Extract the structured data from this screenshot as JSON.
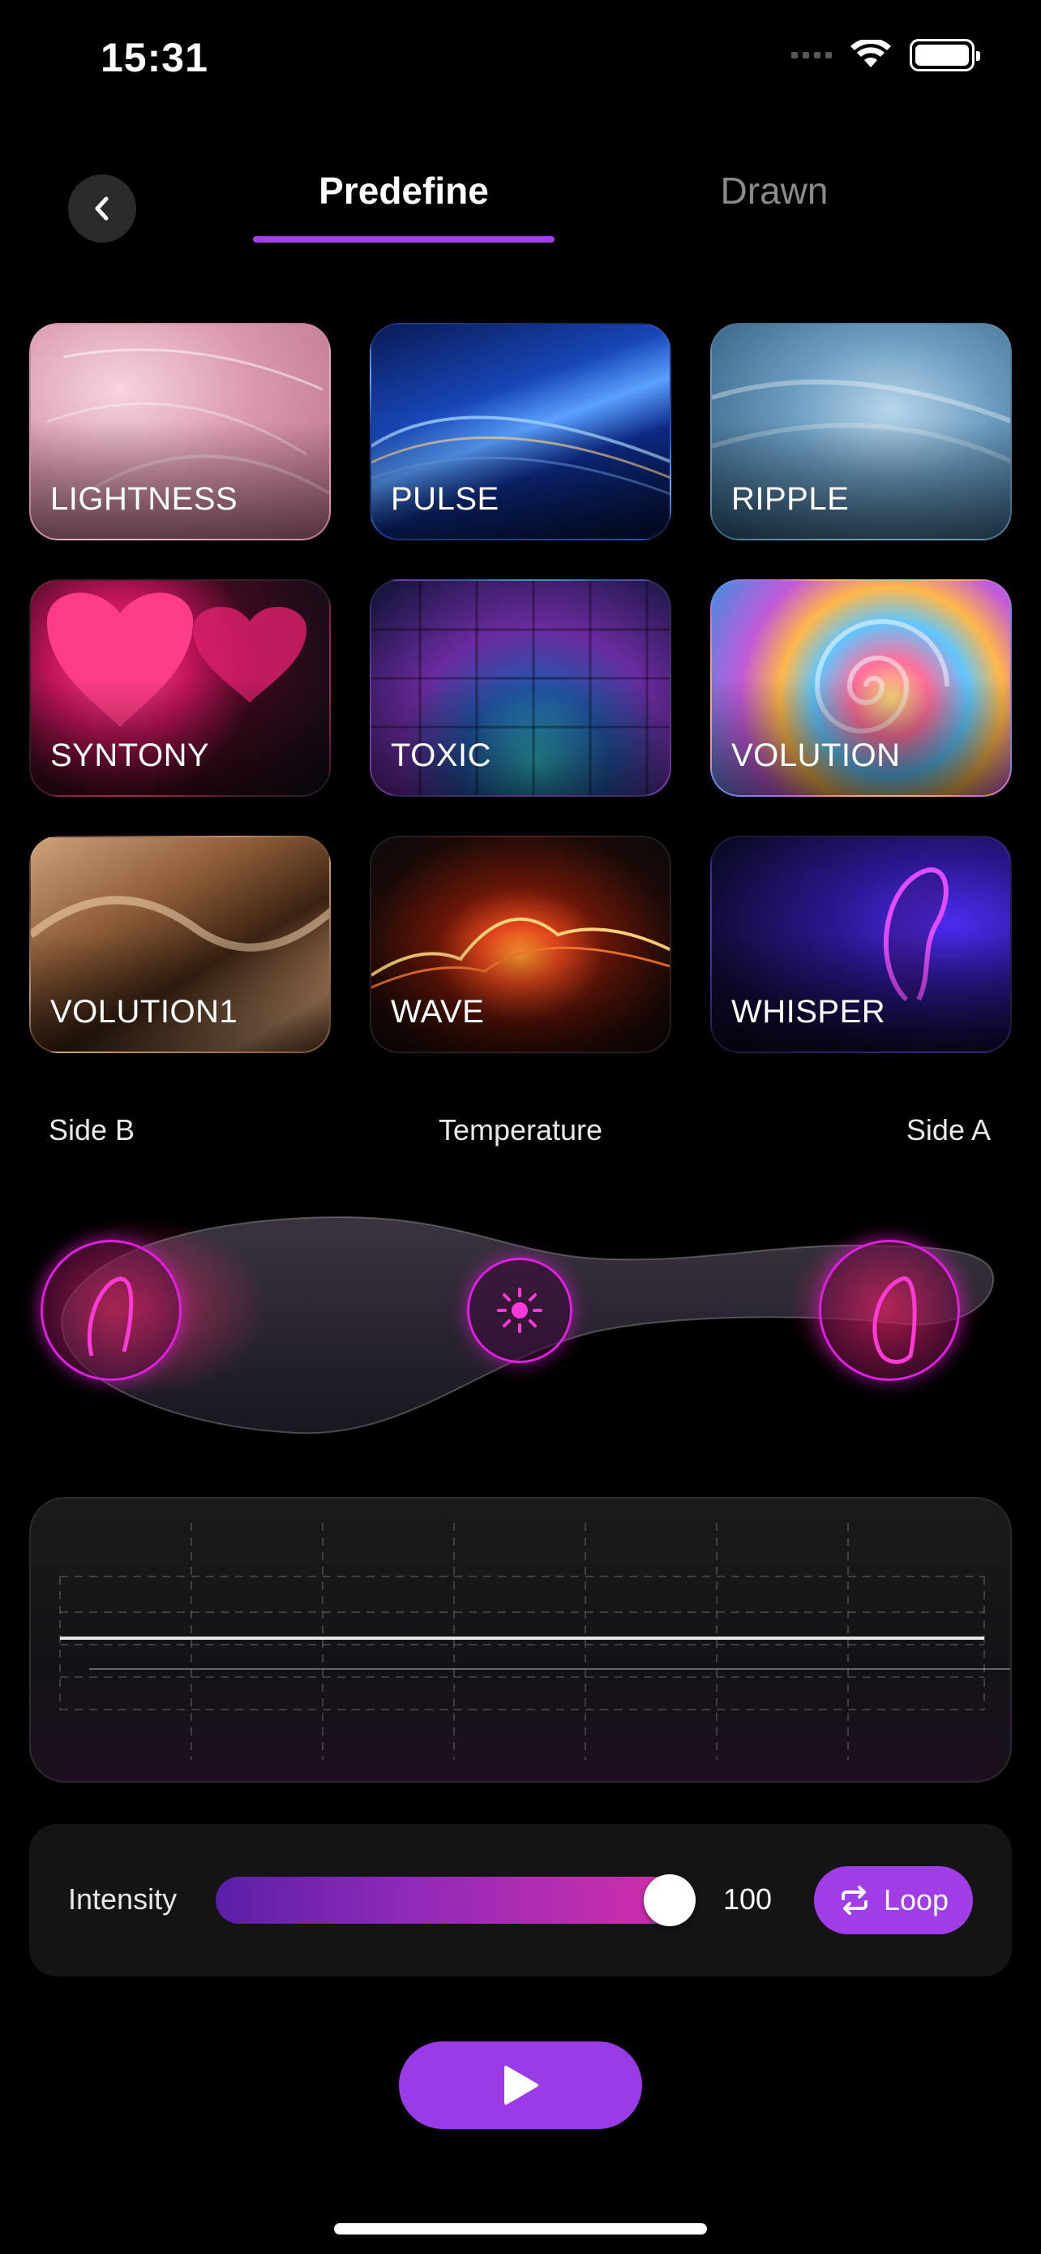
{
  "status_bar": {
    "time": "15:31",
    "icons": [
      "cellular-signal-icon",
      "wifi-icon",
      "battery-icon"
    ]
  },
  "header": {
    "back_icon": "chevron-left-icon",
    "tabs": [
      {
        "label": "Predefine",
        "active": true
      },
      {
        "label": "Drawn",
        "active": false
      }
    ]
  },
  "patterns": [
    {
      "label": "LIGHTNESS"
    },
    {
      "label": "PULSE"
    },
    {
      "label": "RIPPLE"
    },
    {
      "label": "SYNTONY"
    },
    {
      "label": "TOXIC"
    },
    {
      "label": "VOLUTION"
    },
    {
      "label": "VOLUTION1"
    },
    {
      "label": "WAVE"
    },
    {
      "label": "WHISPER"
    }
  ],
  "zones": {
    "side_b": "Side B",
    "temperature": "Temperature",
    "side_a": "Side A"
  },
  "controls": {
    "intensity_label": "Intensity",
    "intensity_value": "100",
    "loop_label": "Loop"
  },
  "colors": {
    "accent": "#a03de6",
    "slider_start": "#5a1fa8",
    "slider_end": "#d62fa8",
    "zone_glow": "#e020e0"
  }
}
